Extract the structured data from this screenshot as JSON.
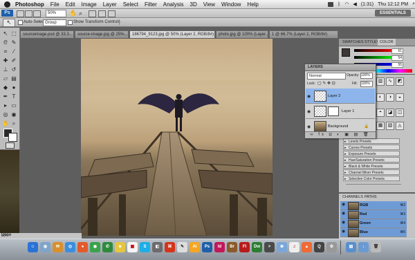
{
  "menubar": {
    "app_name": "Photoshop",
    "items": [
      "File",
      "Edit",
      "Image",
      "Layer",
      "Select",
      "Filter",
      "Analysis",
      "3D",
      "View",
      "Window",
      "Help"
    ],
    "battery": "(1:31)",
    "clock": "Thu 12:12 PM"
  },
  "appbar": {
    "ps_badge": "Ps",
    "zoom": "50%",
    "workspace": "ESSENTIALS"
  },
  "options": {
    "auto_select_label": "Auto-Select:",
    "auto_select_value": "Group",
    "transform_label": "Show Transform Controls"
  },
  "tabs": [
    {
      "label": "sourceimage.psd @ 33.3..."
    },
    {
      "label": "source-image.jpg @ 25%..."
    },
    {
      "label": "186794_9123.jpg @ 50% (Layer 2, RGB/8#) *"
    },
    {
      "label": "photo.jpg @ 100% (Layer..."
    },
    {
      "label": "1 @ 66.7% (Layer 2, RGB/8#)"
    }
  ],
  "document_title": "186794_9123.jpg @ 50% (Layer 2, RGB/8#) *",
  "panels": {
    "swatch_tabs": [
      "SWATCHES",
      "STYLES",
      "COLOR"
    ],
    "color_values": [
      "61",
      "54",
      "55"
    ],
    "adjustment_presets": [
      "Levels Presets",
      "Curves Presets",
      "Exposure Presets",
      "Hue/Saturation Presets",
      "Black & White Presets",
      "Channel Mixer Presets",
      "Selective Color Presets"
    ],
    "channels_tabs": [
      "CHANNELS",
      "PATHS"
    ],
    "channels": [
      {
        "name": "RGB",
        "key": "⌘2"
      },
      {
        "name": "Red",
        "key": "⌘3"
      },
      {
        "name": "Green",
        "key": "⌘4"
      },
      {
        "name": "Blue",
        "key": "⌘5"
      }
    ]
  },
  "layers": {
    "title": "LAYERS",
    "blend_mode": "Normal",
    "opacity_label": "Opacity:",
    "opacity_value": "100%",
    "lock_label": "Lock:",
    "fill_label": "Fill:",
    "fill_value": "100%",
    "items": [
      {
        "name": "Layer 2"
      },
      {
        "name": "Layer 1"
      },
      {
        "name": "Background"
      }
    ]
  },
  "status": {
    "done": "Done",
    "zoom": "50%"
  },
  "dock": {
    "apps": [
      "Ai",
      "Ps",
      "Id",
      "Br",
      "Fl",
      "Dw"
    ]
  },
  "colors": {
    "selection_blue": "#8db5ec",
    "ps_blue": "#1f5fa8"
  }
}
